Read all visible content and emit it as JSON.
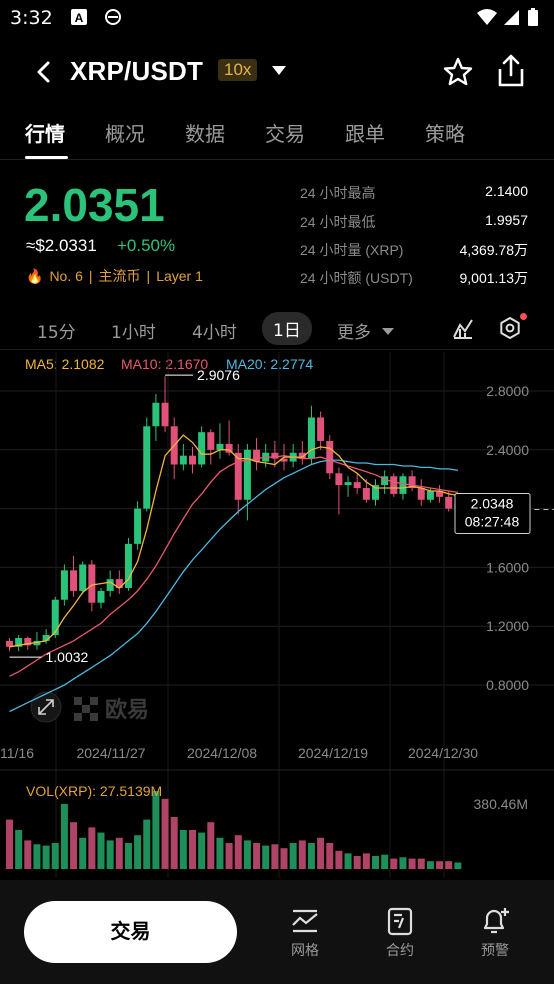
{
  "status_bar": {
    "time": "3:32",
    "icons": [
      "a-icon",
      "e-browser-icon",
      "wifi-icon",
      "signal-icon",
      "battery-icon"
    ]
  },
  "header": {
    "pair": "XRP/USDT",
    "leverage": "10x"
  },
  "tabs": [
    {
      "label": "行情",
      "active": true
    },
    {
      "label": "概况",
      "active": false
    },
    {
      "label": "数据",
      "active": false
    },
    {
      "label": "交易",
      "active": false
    },
    {
      "label": "跟单",
      "active": false
    },
    {
      "label": "策略",
      "active": false
    }
  ],
  "ticker": {
    "price": "2.0351",
    "approx_usd": "≈$2.0331",
    "change": "+0.50%",
    "rank": "No. 6",
    "tag1": "主流币",
    "tag2": "Layer 1",
    "sep": "|"
  },
  "stats": [
    {
      "label": "24 小时最高",
      "value": "2.1400"
    },
    {
      "label": "24 小时最低",
      "value": "1.9957"
    },
    {
      "label": "24 小时量 (XRP)",
      "value": "4,369.78万"
    },
    {
      "label": "24 小时额 (USDT)",
      "value": "9,001.13万"
    }
  ],
  "periods": [
    {
      "label": "15分",
      "active": false
    },
    {
      "label": "1小时",
      "active": false
    },
    {
      "label": "4小时",
      "active": false
    },
    {
      "label": "1日",
      "active": true
    },
    {
      "label": "更多",
      "active": false
    }
  ],
  "ma_labels": {
    "ma5": "MA5: 2.1082",
    "ma10": "MA10: 2.1670",
    "ma20": "MA20: 2.2774"
  },
  "colors": {
    "up": "#2bc37a",
    "down": "#e0527a",
    "ma5": "#f0b53a",
    "ma10": "#e8596e",
    "ma20": "#4fb8e0",
    "accent": "#e3a23a"
  },
  "chart_data": {
    "type": "candlestick",
    "y_ticks": [
      "2.8000",
      "2.4000",
      "2.0000",
      "1.6000",
      "1.2000",
      "0.8000"
    ],
    "ylim": [
      0.6,
      2.92
    ],
    "x_ticks": [
      "11/16",
      "2024/11/27",
      "2024/12/08",
      "2024/12/19",
      "2024/12/30"
    ],
    "high_marker": "2.9076",
    "low_marker": "1.0032",
    "current_price": "2.0348",
    "countdown": "08:27:48",
    "watermark": "欧易",
    "candles": [
      [
        1.1,
        1.12,
        1.03,
        1.06
      ],
      [
        1.06,
        1.14,
        1.03,
        1.12
      ],
      [
        1.12,
        1.13,
        1.04,
        1.07
      ],
      [
        1.07,
        1.16,
        1.04,
        1.1
      ],
      [
        1.1,
        1.18,
        1.08,
        1.14
      ],
      [
        1.14,
        1.4,
        1.12,
        1.38
      ],
      [
        1.38,
        1.62,
        1.34,
        1.58
      ],
      [
        1.58,
        1.68,
        1.4,
        1.44
      ],
      [
        1.44,
        1.64,
        1.42,
        1.62
      ],
      [
        1.62,
        1.65,
        1.3,
        1.36
      ],
      [
        1.36,
        1.46,
        1.32,
        1.44
      ],
      [
        1.44,
        1.58,
        1.4,
        1.52
      ],
      [
        1.52,
        1.58,
        1.42,
        1.46
      ],
      [
        1.46,
        1.8,
        1.44,
        1.76
      ],
      [
        1.76,
        2.05,
        1.72,
        2.0
      ],
      [
        2.0,
        2.62,
        1.98,
        2.56
      ],
      [
        2.56,
        2.78,
        2.46,
        2.72
      ],
      [
        2.72,
        2.9,
        2.52,
        2.56
      ],
      [
        2.56,
        2.62,
        2.2,
        2.3
      ],
      [
        2.3,
        2.44,
        2.26,
        2.36
      ],
      [
        2.36,
        2.42,
        2.24,
        2.3
      ],
      [
        2.3,
        2.56,
        2.28,
        2.52
      ],
      [
        2.52,
        2.54,
        2.3,
        2.4
      ],
      [
        2.4,
        2.58,
        2.34,
        2.44
      ],
      [
        2.44,
        2.6,
        2.36,
        2.38
      ],
      [
        2.38,
        2.44,
        1.96,
        2.06
      ],
      [
        2.06,
        2.44,
        1.92,
        2.4
      ],
      [
        2.4,
        2.48,
        2.26,
        2.32
      ],
      [
        2.32,
        2.44,
        2.28,
        2.38
      ],
      [
        2.38,
        2.46,
        2.28,
        2.34
      ],
      [
        2.34,
        2.44,
        2.26,
        2.32
      ],
      [
        2.32,
        2.44,
        2.28,
        2.38
      ],
      [
        2.38,
        2.46,
        2.3,
        2.34
      ],
      [
        2.34,
        2.7,
        2.3,
        2.62
      ],
      [
        2.62,
        2.66,
        2.4,
        2.46
      ],
      [
        2.46,
        2.5,
        2.2,
        2.24
      ],
      [
        2.24,
        2.28,
        1.96,
        2.16
      ],
      [
        2.16,
        2.22,
        2.08,
        2.18
      ],
      [
        2.18,
        2.24,
        2.1,
        2.14
      ],
      [
        2.14,
        2.2,
        2.04,
        2.06
      ],
      [
        2.06,
        2.2,
        2.02,
        2.16
      ],
      [
        2.16,
        2.26,
        2.1,
        2.22
      ],
      [
        2.22,
        2.24,
        2.08,
        2.1
      ],
      [
        2.1,
        2.24,
        2.06,
        2.22
      ],
      [
        2.22,
        2.26,
        2.12,
        2.14
      ],
      [
        2.14,
        2.2,
        2.02,
        2.06
      ],
      [
        2.06,
        2.14,
        2.04,
        2.12
      ],
      [
        2.12,
        2.16,
        2.04,
        2.08
      ],
      [
        2.08,
        2.12,
        1.98,
        2.0
      ],
      [
        2.0,
        2.06,
        1.96,
        2.03
      ]
    ],
    "ma5": [
      1.06,
      1.07,
      1.08,
      1.09,
      1.1,
      1.16,
      1.26,
      1.34,
      1.43,
      1.48,
      1.49,
      1.5,
      1.46,
      1.52,
      1.64,
      1.86,
      2.12,
      2.36,
      2.43,
      2.5,
      2.45,
      2.37,
      2.37,
      2.4,
      2.4,
      2.34,
      2.34,
      2.32,
      2.31,
      2.3,
      2.35,
      2.35,
      2.35,
      2.4,
      2.42,
      2.41,
      2.36,
      2.28,
      2.24,
      2.18,
      2.14,
      2.14,
      2.14,
      2.14,
      2.15,
      2.14,
      2.12,
      2.12,
      2.1,
      2.09
    ],
    "ma10": [
      0.86,
      0.89,
      0.93,
      0.97,
      1.01,
      1.04,
      1.07,
      1.1,
      1.14,
      1.18,
      1.22,
      1.28,
      1.33,
      1.38,
      1.44,
      1.52,
      1.61,
      1.72,
      1.83,
      1.93,
      2.03,
      2.1,
      2.18,
      2.25,
      2.29,
      2.32,
      2.33,
      2.34,
      2.35,
      2.35,
      2.36,
      2.35,
      2.34,
      2.34,
      2.35,
      2.33,
      2.31,
      2.29,
      2.27,
      2.25,
      2.23,
      2.2,
      2.18,
      2.17,
      2.16,
      2.15,
      2.14,
      2.13,
      2.12,
      2.11
    ],
    "ma20": [
      0.62,
      0.65,
      0.68,
      0.71,
      0.74,
      0.77,
      0.8,
      0.84,
      0.88,
      0.92,
      0.96,
      1.0,
      1.05,
      1.1,
      1.15,
      1.22,
      1.3,
      1.39,
      1.48,
      1.57,
      1.65,
      1.72,
      1.79,
      1.86,
      1.92,
      1.98,
      2.03,
      2.08,
      2.13,
      2.17,
      2.21,
      2.24,
      2.27,
      2.3,
      2.32,
      2.33,
      2.33,
      2.32,
      2.31,
      2.31,
      2.3,
      2.3,
      2.3,
      2.29,
      2.29,
      2.28,
      2.28,
      2.27,
      2.27,
      2.26
    ],
    "volumes": [
      190,
      150,
      110,
      95,
      90,
      100,
      250,
      180,
      120,
      160,
      140,
      110,
      120,
      100,
      130,
      190,
      300,
      270,
      200,
      150,
      150,
      140,
      180,
      120,
      100,
      130,
      110,
      100,
      90,
      95,
      80,
      100,
      110,
      100,
      120,
      100,
      70,
      60,
      50,
      60,
      50,
      55,
      40,
      45,
      40,
      40,
      30,
      30,
      30,
      25
    ]
  },
  "volume": {
    "label": "VOL(XRP): 27.5139M",
    "max": "380.46M"
  },
  "bottom_bar": {
    "trade": "交易",
    "grid": "网格",
    "contract": "合约",
    "alert": "预警"
  }
}
